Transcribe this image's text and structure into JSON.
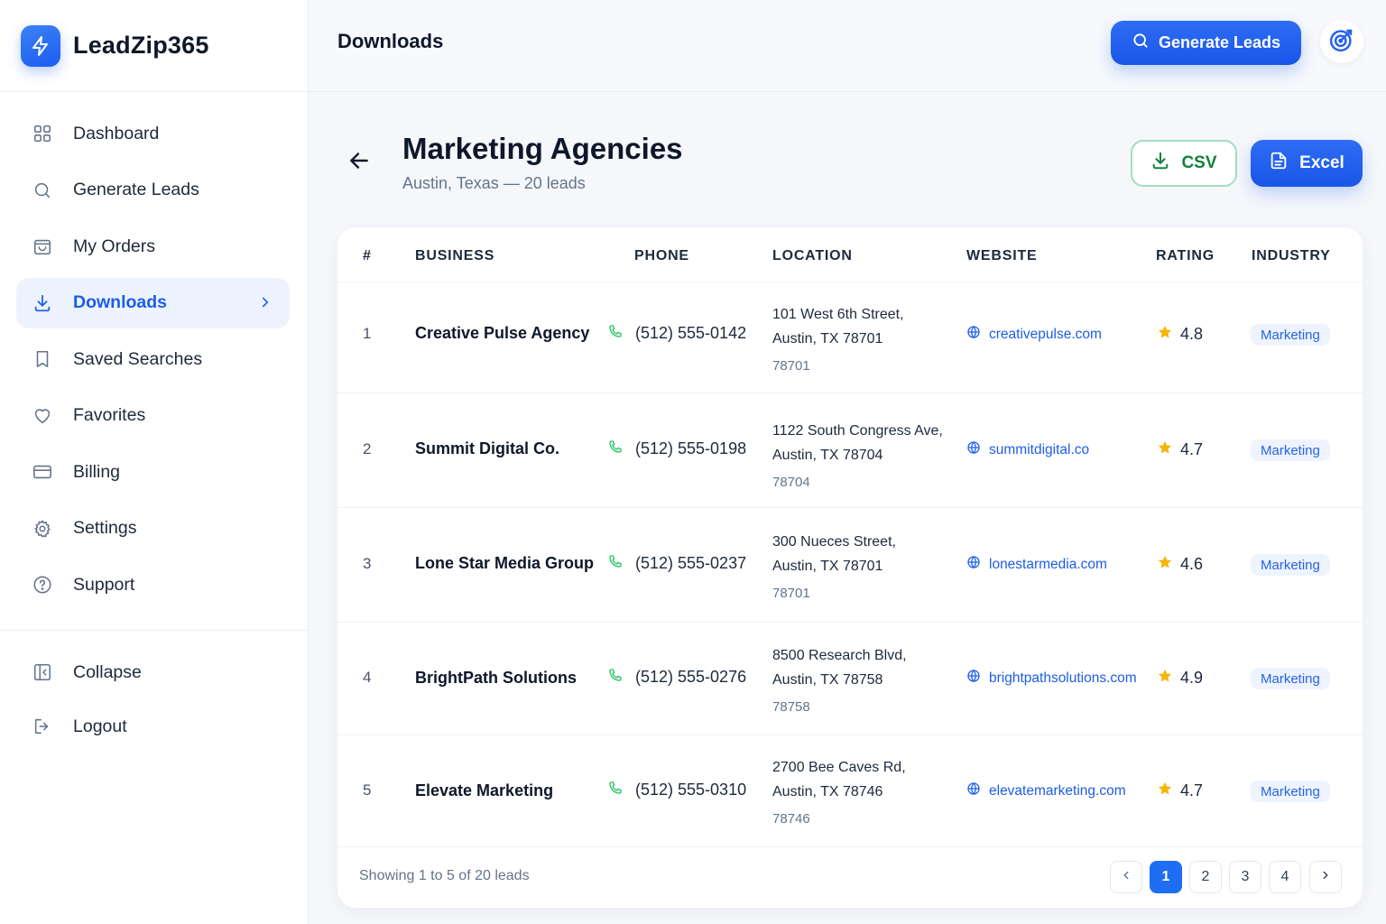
{
  "app": {
    "name": "LeadZip365"
  },
  "sidebar": {
    "items": [
      {
        "label": "Dashboard",
        "icon": "grid-icon"
      },
      {
        "label": "Generate Leads",
        "icon": "search-icon"
      },
      {
        "label": "My Orders",
        "icon": "shopping-bag-icon"
      },
      {
        "label": "Downloads",
        "icon": "download-icon",
        "active": true
      },
      {
        "label": "Saved Searches",
        "icon": "bookmark-icon"
      },
      {
        "label": "Favorites",
        "icon": "heart-icon"
      },
      {
        "label": "Billing",
        "icon": "credit-card-icon"
      },
      {
        "label": "Settings",
        "icon": "gear-icon"
      },
      {
        "label": "Support",
        "icon": "help-circle-icon"
      }
    ],
    "bottom": [
      {
        "label": "Collapse",
        "icon": "collapse-icon"
      },
      {
        "label": "Logout",
        "icon": "logout-icon"
      }
    ]
  },
  "header": {
    "title": "Downloads",
    "generate_label": "Generate Leads"
  },
  "list": {
    "title": "Marketing Agencies",
    "subtitle": "Austin, Texas — 20 leads",
    "csv_label": "CSV",
    "excel_label": "Excel"
  },
  "table": {
    "columns": [
      "#",
      "BUSINESS",
      "PHONE",
      "LOCATION",
      "WEBSITE",
      "RATING",
      "INDUSTRY"
    ],
    "rows": [
      {
        "num": "1",
        "business": "Creative Pulse Agency",
        "phone": "(512) 555-0142",
        "street": "101 West 6th Street,",
        "city": "Austin, TX 78701",
        "zip": "78701",
        "website": "creativepulse.com",
        "rating": "4.8",
        "industry": "Marketing"
      },
      {
        "num": "2",
        "business": "Summit Digital Co.",
        "phone": "(512) 555-0198",
        "street": "1122 South Congress Ave,",
        "city": "Austin, TX 78704",
        "zip": "78704",
        "website": "summitdigital.co",
        "rating": "4.7",
        "industry": "Marketing"
      },
      {
        "num": "3",
        "business": "Lone Star Media Group",
        "phone": "(512) 555-0237",
        "street": "300 Nueces Street,",
        "city": "Austin, TX 78701",
        "zip": "78701",
        "website": "lonestarmedia.com",
        "rating": "4.6",
        "industry": "Marketing"
      },
      {
        "num": "4",
        "business": "BrightPath Solutions",
        "phone": "(512) 555-0276",
        "street": "8500 Research Blvd,",
        "city": "Austin, TX 78758",
        "zip": "78758",
        "website": "brightpathsolutions.com",
        "rating": "4.9",
        "industry": "Marketing"
      },
      {
        "num": "5",
        "business": "Elevate Marketing",
        "phone": "(512) 555-0310",
        "street": "2700 Bee Caves Rd,",
        "city": "Austin, TX 78746",
        "zip": "78746",
        "website": "elevatemarketing.com",
        "rating": "4.7",
        "industry": "Marketing"
      }
    ]
  },
  "footer": {
    "showing": "Showing 1 to 5 of 20 leads",
    "pages": [
      "1",
      "2",
      "3",
      "4"
    ],
    "current_page": "1"
  },
  "colors": {
    "accent": "#2563eb",
    "csv_green": "#15803d",
    "star": "#f5b50a",
    "phone_green": "#22c55e"
  }
}
